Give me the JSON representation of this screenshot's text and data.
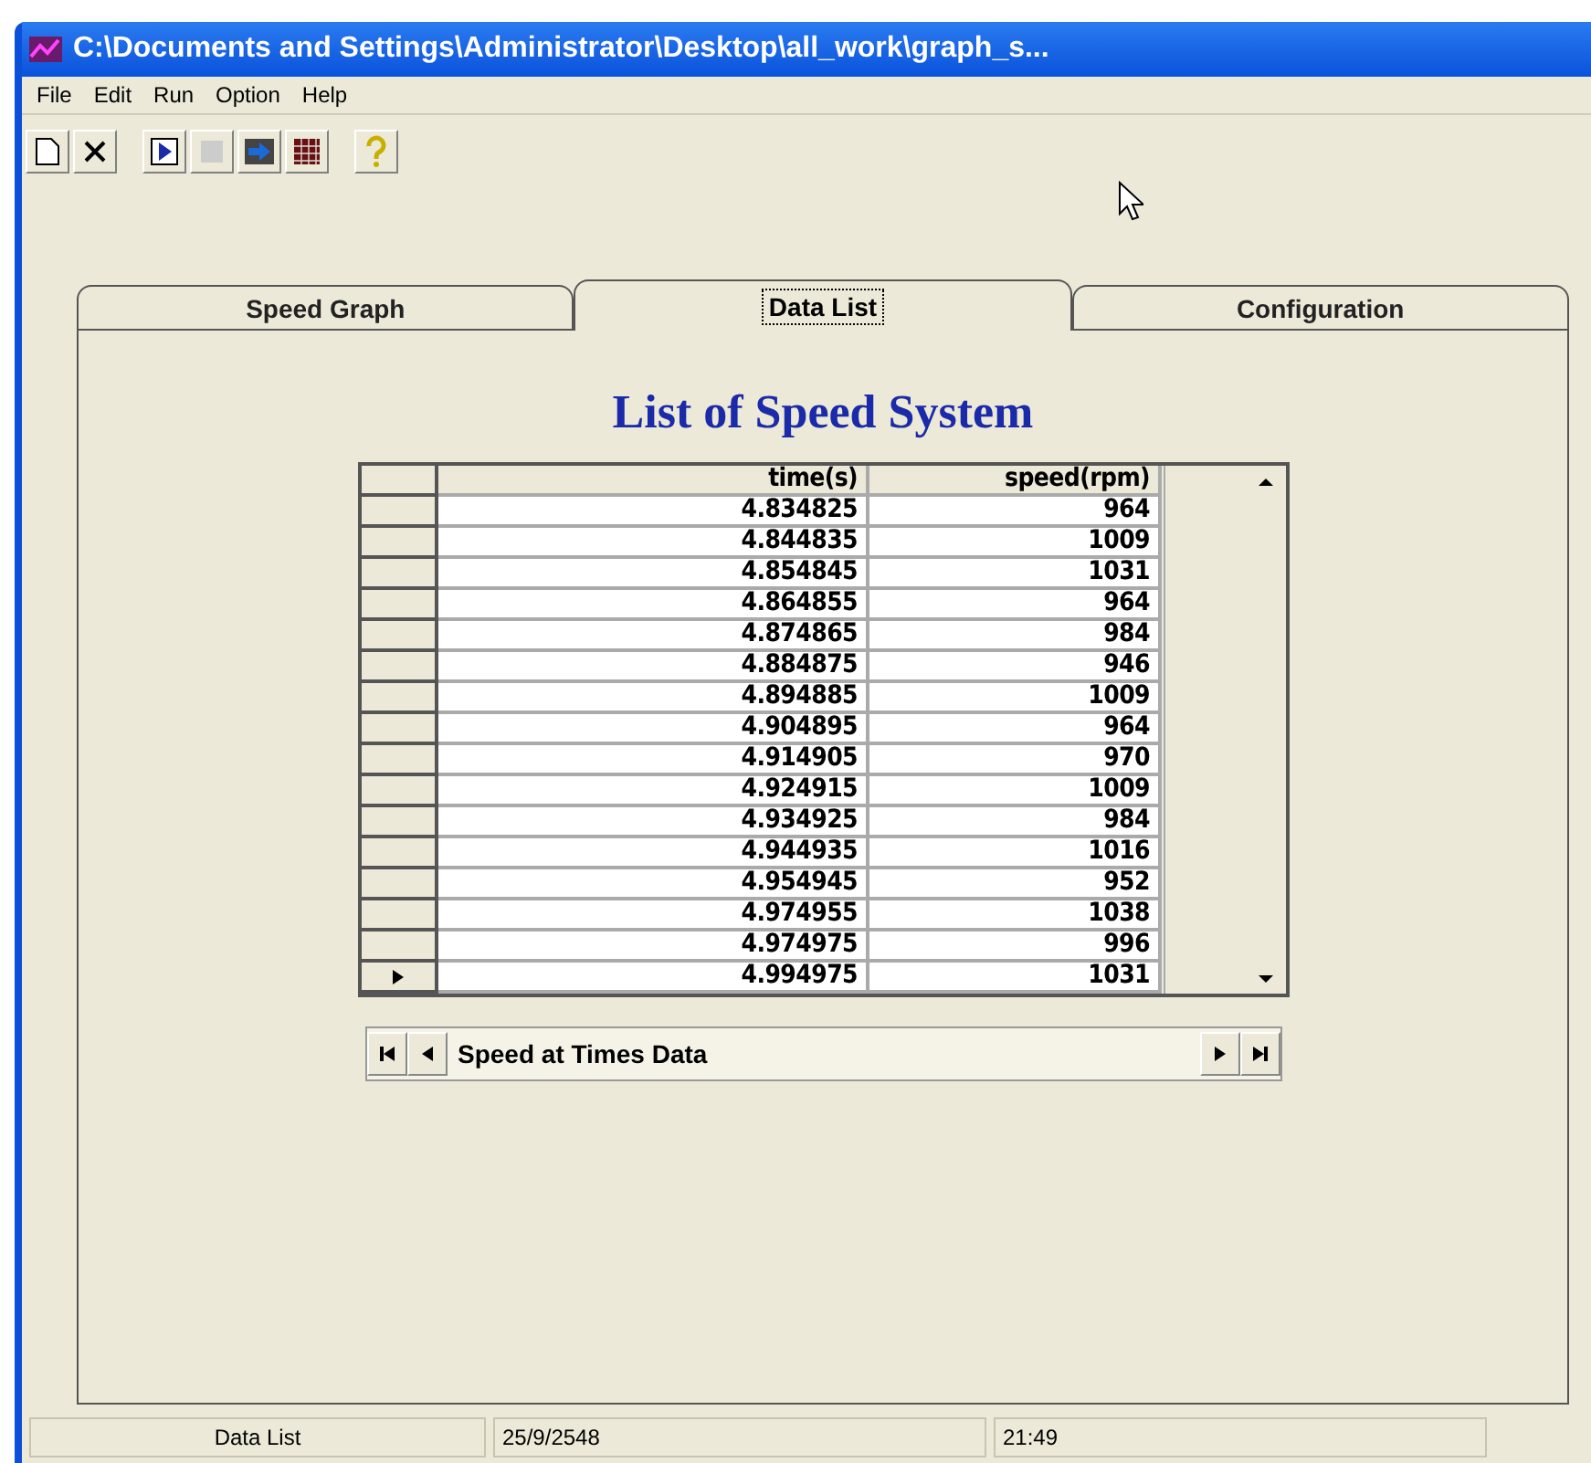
{
  "window": {
    "title": "C:\\Documents and Settings\\Administrator\\Desktop\\all_work\\graph_s..."
  },
  "menu": [
    "File",
    "Edit",
    "Run",
    "Option",
    "Help"
  ],
  "toolbar": [
    {
      "kind": "new",
      "disabled": false
    },
    {
      "kind": "delete",
      "disabled": false
    },
    {
      "kind": "run",
      "disabled": false
    },
    {
      "kind": "stop",
      "disabled": true
    },
    {
      "kind": "export",
      "disabled": false
    },
    {
      "kind": "grid",
      "disabled": false
    },
    {
      "kind": "help",
      "disabled": false
    }
  ],
  "tabs": [
    {
      "label": "Speed Graph",
      "selected": false
    },
    {
      "label": "Data List",
      "selected": true
    },
    {
      "label": "Configuration",
      "selected": false
    }
  ],
  "heading": "List of Speed System",
  "table": {
    "columns": [
      "time(s)",
      "speed(rpm)"
    ],
    "rows": [
      {
        "cells": [
          "4.834825",
          "964"
        ],
        "current": false
      },
      {
        "cells": [
          "4.844835",
          "1009"
        ],
        "current": false
      },
      {
        "cells": [
          "4.854845",
          "1031"
        ],
        "current": false
      },
      {
        "cells": [
          "4.864855",
          "964"
        ],
        "current": false
      },
      {
        "cells": [
          "4.874865",
          "984"
        ],
        "current": false
      },
      {
        "cells": [
          "4.884875",
          "946"
        ],
        "current": false
      },
      {
        "cells": [
          "4.894885",
          "1009"
        ],
        "current": false
      },
      {
        "cells": [
          "4.904895",
          "964"
        ],
        "current": false
      },
      {
        "cells": [
          "4.914905",
          "970"
        ],
        "current": false
      },
      {
        "cells": [
          "4.924915",
          "1009"
        ],
        "current": false
      },
      {
        "cells": [
          "4.934925",
          "984"
        ],
        "current": false
      },
      {
        "cells": [
          "4.944935",
          "1016"
        ],
        "current": false
      },
      {
        "cells": [
          "4.954945",
          "952"
        ],
        "current": false
      },
      {
        "cells": [
          "4.974955",
          "1038"
        ],
        "current": false
      },
      {
        "cells": [
          "4.974975",
          "996"
        ],
        "current": false
      },
      {
        "cells": [
          "4.994975",
          "1031"
        ],
        "current": true
      }
    ]
  },
  "navigator": {
    "caption": "Speed at Times Data"
  },
  "status_bar": [
    "Data List",
    "25/9/2548",
    "21:49"
  ]
}
